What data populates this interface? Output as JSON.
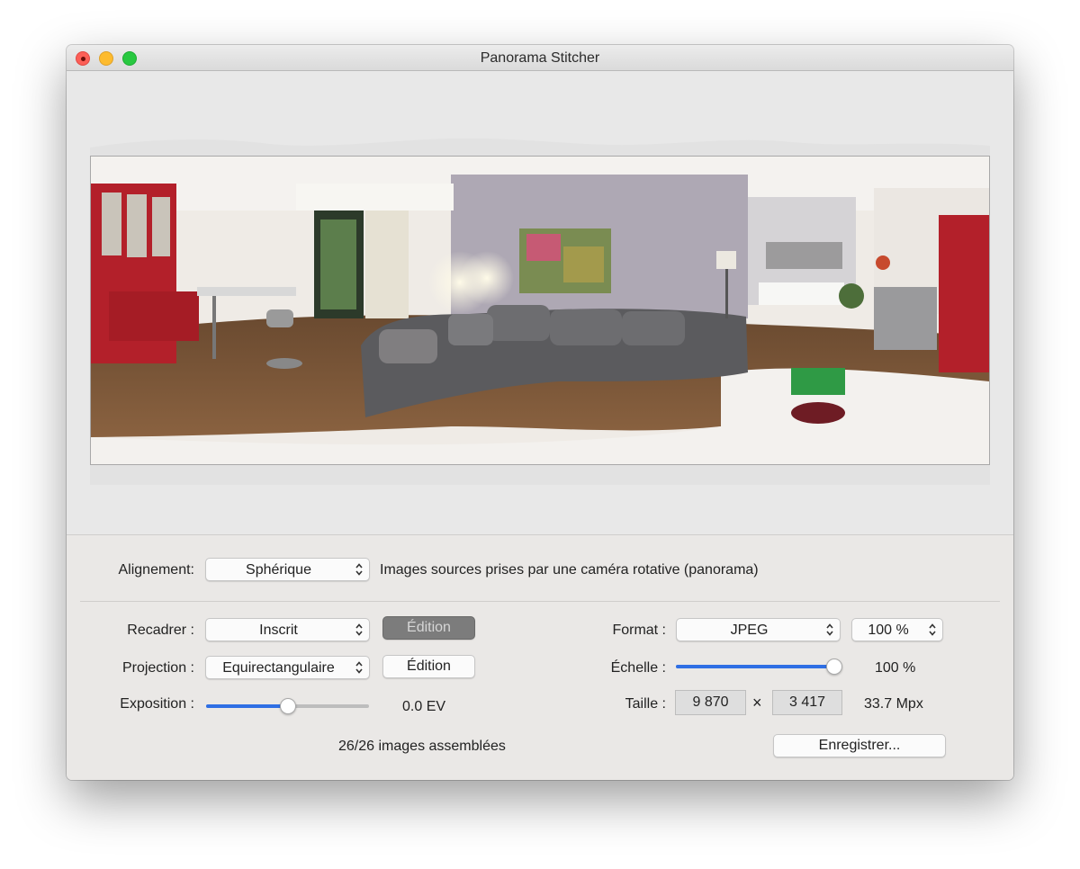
{
  "window": {
    "title": "Panorama Stitcher"
  },
  "alignment": {
    "label": "Alignement:",
    "value": "Sphérique",
    "description": "Images sources prises par une caméra rotative (panorama)"
  },
  "crop": {
    "label": "Recadrer :",
    "value": "Inscrit",
    "edit_button": "Édition",
    "edit_pressed": true
  },
  "projection": {
    "label": "Projection :",
    "value": "Equirectangulaire",
    "edit_button": "Édition"
  },
  "exposure": {
    "label": "Exposition :",
    "value_text": "0.0 EV",
    "level_fraction": 0.5
  },
  "format": {
    "label": "Format :",
    "value": "JPEG",
    "quality": "100 %"
  },
  "scale": {
    "label": "Échelle :",
    "value_text": "100 %",
    "level_fraction": 1.0
  },
  "size": {
    "label": "Taille :",
    "width": "9 870",
    "separator": "×",
    "height": "3 417",
    "megapixels": "33.7 Mpx"
  },
  "status": "26/26 images assemblées",
  "save_button": "Enregistrer...",
  "colors": {
    "accent": "#2f6fe4",
    "cabinet_red": "#b3202a",
    "sofa_gray": "#5b5b5e"
  }
}
